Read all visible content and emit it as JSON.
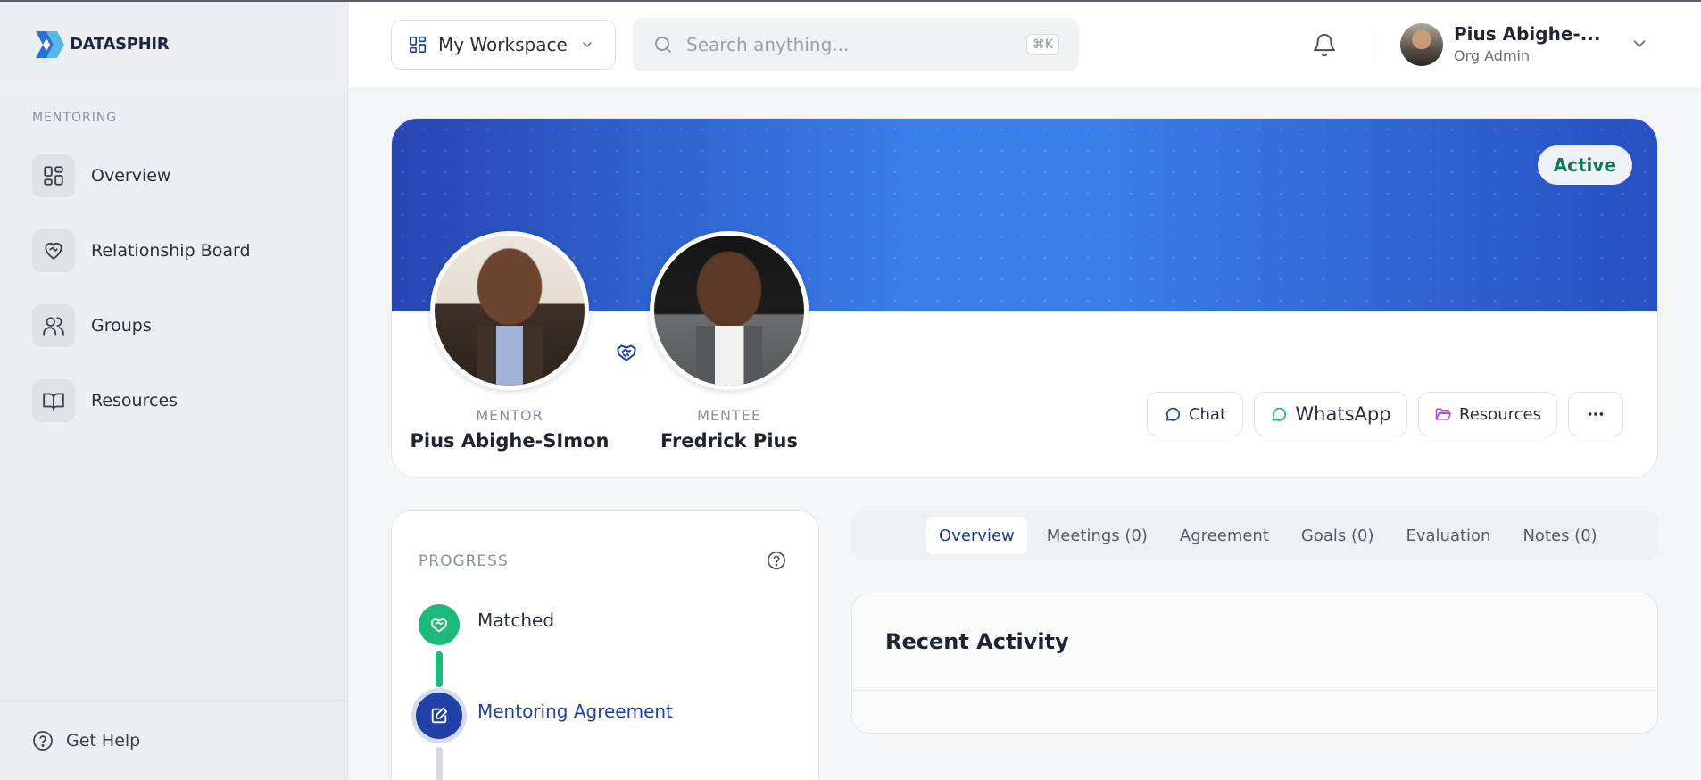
{
  "brand": {
    "name": "DATASPHIR",
    "colors": {
      "primary": "#2b6fd9",
      "dark": "#1c2640"
    }
  },
  "sidebar": {
    "section_label": "MENTORING",
    "items": [
      {
        "label": "Overview",
        "icon": "grid-icon"
      },
      {
        "label": "Relationship Board",
        "icon": "heart-handshake-icon"
      },
      {
        "label": "Groups",
        "icon": "users-icon"
      },
      {
        "label": "Resources",
        "icon": "book-open-icon"
      }
    ],
    "help_label": "Get Help"
  },
  "header": {
    "workspace_label": "My Workspace",
    "search_placeholder": "Search anything...",
    "search_shortcut": "⌘K",
    "user_name": "Pius Abighe-...",
    "user_role": "Org Admin"
  },
  "hero": {
    "status": "Active",
    "status_color": "#0f7a52",
    "mentor": {
      "role": "MENTOR",
      "name": "Pius Abighe-SImon"
    },
    "mentee": {
      "role": "MENTEE",
      "name": "Fredrick Pius"
    },
    "actions": {
      "chat": "Chat",
      "whatsapp": "WhatsApp",
      "resources": "Resources"
    }
  },
  "progress": {
    "title": "PROGRESS",
    "steps": [
      {
        "label": "Matched",
        "state": "complete",
        "color": "#1db97a"
      },
      {
        "label": "Mentoring Agreement",
        "state": "current",
        "color": "#2140a8"
      }
    ]
  },
  "tabs": [
    {
      "label": "Overview",
      "active": true
    },
    {
      "label": "Meetings (0)",
      "active": false
    },
    {
      "label": "Agreement",
      "active": false
    },
    {
      "label": "Goals (0)",
      "active": false
    },
    {
      "label": "Evaluation",
      "active": false
    },
    {
      "label": "Notes (0)",
      "active": false
    }
  ],
  "activity": {
    "title": "Recent Activity"
  }
}
